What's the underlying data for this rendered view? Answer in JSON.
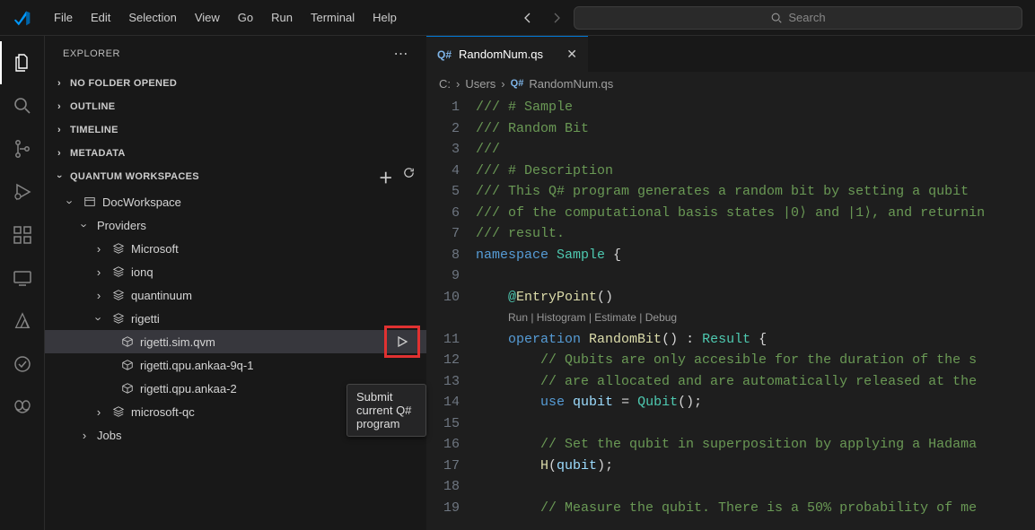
{
  "menubar": {
    "items": [
      "File",
      "Edit",
      "Selection",
      "View",
      "Go",
      "Run",
      "Terminal",
      "Help"
    ]
  },
  "search": {
    "placeholder": "Search"
  },
  "explorer": {
    "title": "EXPLORER",
    "sections": {
      "noFolder": "NO FOLDER OPENED",
      "outline": "OUTLINE",
      "timeline": "TIMELINE",
      "metadata": "METADATA",
      "quantumWorkspaces": "QUANTUM WORKSPACES"
    },
    "tree": {
      "workspace": "DocWorkspace",
      "providersLabel": "Providers",
      "providers": {
        "microsoft": "Microsoft",
        "ionq": "ionq",
        "quantinuum": "quantinuum",
        "rigetti": "rigetti",
        "microsoftqc": "microsoft-qc"
      },
      "rigetti_targets": {
        "sim": "rigetti.sim.qvm",
        "qpu1": "rigetti.qpu.ankaa-9q-1",
        "qpu2": "rigetti.qpu.ankaa-2"
      },
      "jobs": "Jobs"
    }
  },
  "tooltip": {
    "text": "Submit current Q# program"
  },
  "tab": {
    "language": "Q#",
    "title": "RandomNum.qs"
  },
  "breadcrumb": {
    "c": "C:",
    "users": "Users",
    "lang": "Q#",
    "file": "RandomNum.qs"
  },
  "code": {
    "codelens": "Run | Histogram | Estimate | Debug",
    "lines": [
      "/// # Sample",
      "/// Random Bit",
      "///",
      "/// # Description",
      "/// This Q# program generates a random bit by setting a qubit ",
      "/// of the computational basis states |0⟩ and |1⟩, and returnin",
      "/// result.",
      "namespace Sample {",
      "",
      "    @EntryPoint()",
      "__CODELENS__",
      "    operation RandomBit() : Result {",
      "        // Qubits are only accesible for the duration of the s",
      "        // are allocated and are automatically released at the",
      "        use qubit = Qubit();",
      "",
      "        // Set the qubit in superposition by applying a Hadama",
      "        H(qubit);",
      "",
      "        // Measure the qubit. There is a 50% probability of me"
    ]
  },
  "icons": {
    "explorer": "files-icon",
    "search": "search-icon",
    "scm": "source-control-icon",
    "debug": "debug-icon",
    "extensions": "extensions-icon",
    "remote": "remote-icon",
    "azure": "azure-icon",
    "testing": "testing-icon",
    "copilot": "copilot-icon"
  }
}
